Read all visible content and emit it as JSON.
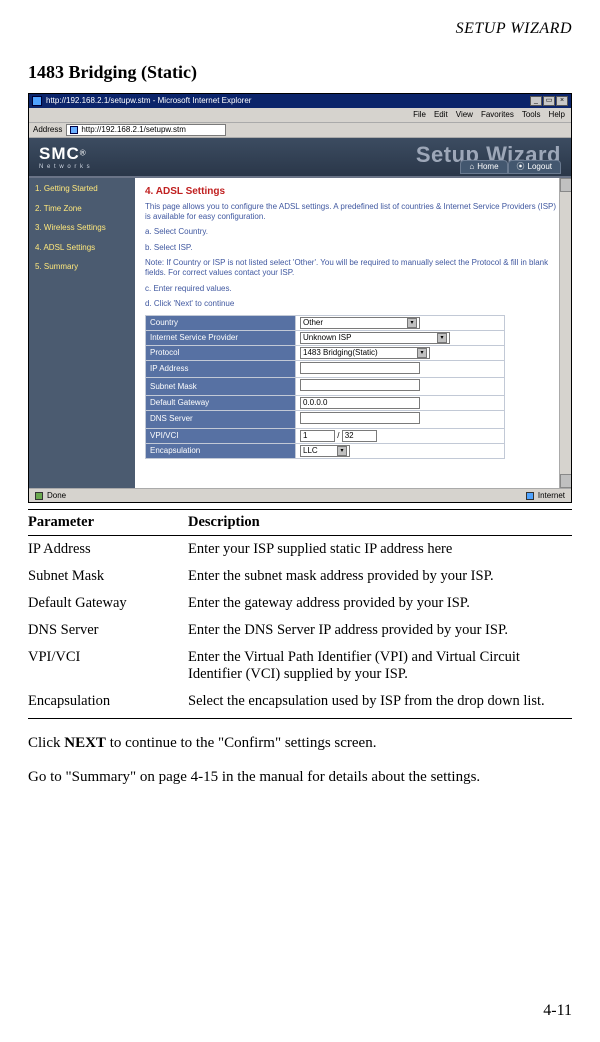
{
  "running_head": "SETUP WIZARD",
  "section_title": "1483 Bridging (Static)",
  "browser": {
    "title": "http://192.168.2.1/setupw.stm - Microsoft Internet Explorer",
    "menus": [
      "File",
      "Edit",
      "View",
      "Favorites",
      "Tools",
      "Help"
    ],
    "addr_label": "Address",
    "url": "http://192.168.2.1/setupw.stm",
    "win_min": "_",
    "win_max": "▭",
    "win_close": "×"
  },
  "router": {
    "logo_big": "SMC",
    "logo_reg": "®",
    "logo_sub": "N e t w o r k s",
    "banner": "Setup Wizard",
    "home": "Home",
    "logout": "Logout"
  },
  "sidebar": {
    "items": [
      {
        "label": "1. Getting Started"
      },
      {
        "label": "2. Time Zone"
      },
      {
        "label": "3. Wireless Settings"
      },
      {
        "label": "4. ADSL Settings"
      },
      {
        "label": "5. Summary"
      }
    ]
  },
  "content": {
    "title": "4. ADSL Settings",
    "p1": "This page allows you to configure the ADSL settings. A predefined list of countries & Internet Service Providers (ISP) is available for easy configuration.",
    "pa": "a. Select Country.",
    "pb": "b. Select ISP.",
    "note": "Note: If Country or ISP is not listed select 'Other'. You will be required to manually select the Protocol & fill in blank fields. For correct values contact your ISP.",
    "pc": "c. Enter required values.",
    "pd": "d. Click 'Next' to continue",
    "fields": {
      "country_lbl": "Country",
      "country_val": "Other",
      "isp_lbl": "Internet Service Provider",
      "isp_val": "Unknown ISP",
      "proto_lbl": "Protocol",
      "proto_val": "1483 Bridging(Static)",
      "ip_lbl": "IP Address",
      "ip_val": "",
      "mask_lbl": "Subnet Mask",
      "mask_val": "",
      "gw_lbl": "Default Gateway",
      "gw_val": "0.0.0.0",
      "dns_lbl": "DNS Server",
      "dns_val": "",
      "vpi_lbl": "VPI/VCI",
      "vpi_val": "1",
      "vci_val": "32",
      "enc_lbl": "Encapsulation",
      "enc_val": "LLC"
    }
  },
  "statusbar": {
    "left": "Done",
    "right": "Internet"
  },
  "param_table": {
    "head1": "Parameter",
    "head2": "Description",
    "rows": [
      {
        "p": "IP Address",
        "d": "Enter your ISP supplied static IP address here"
      },
      {
        "p": "Subnet Mask",
        "d": "Enter the subnet mask address provided by your ISP."
      },
      {
        "p": "Default Gateway",
        "d": "Enter the gateway address provided by your ISP."
      },
      {
        "p": "DNS Server",
        "d": "Enter the DNS Server IP address provided by your ISP."
      },
      {
        "p": "VPI/VCI",
        "d": "Enter the Virtual Path Identifier (VPI) and Virtual Circuit Identifier (VCI) supplied by your ISP."
      },
      {
        "p": "Encapsulation",
        "d": "Select the encapsulation used by ISP from the drop down list."
      }
    ]
  },
  "body1a": "Click ",
  "body1b": "NEXT",
  "body1c": " to continue to the \"Confirm\" settings screen.",
  "body2": "Go to \"Summary\" on page 4-15 in the manual for details about the settings.",
  "page_num": "4-11"
}
